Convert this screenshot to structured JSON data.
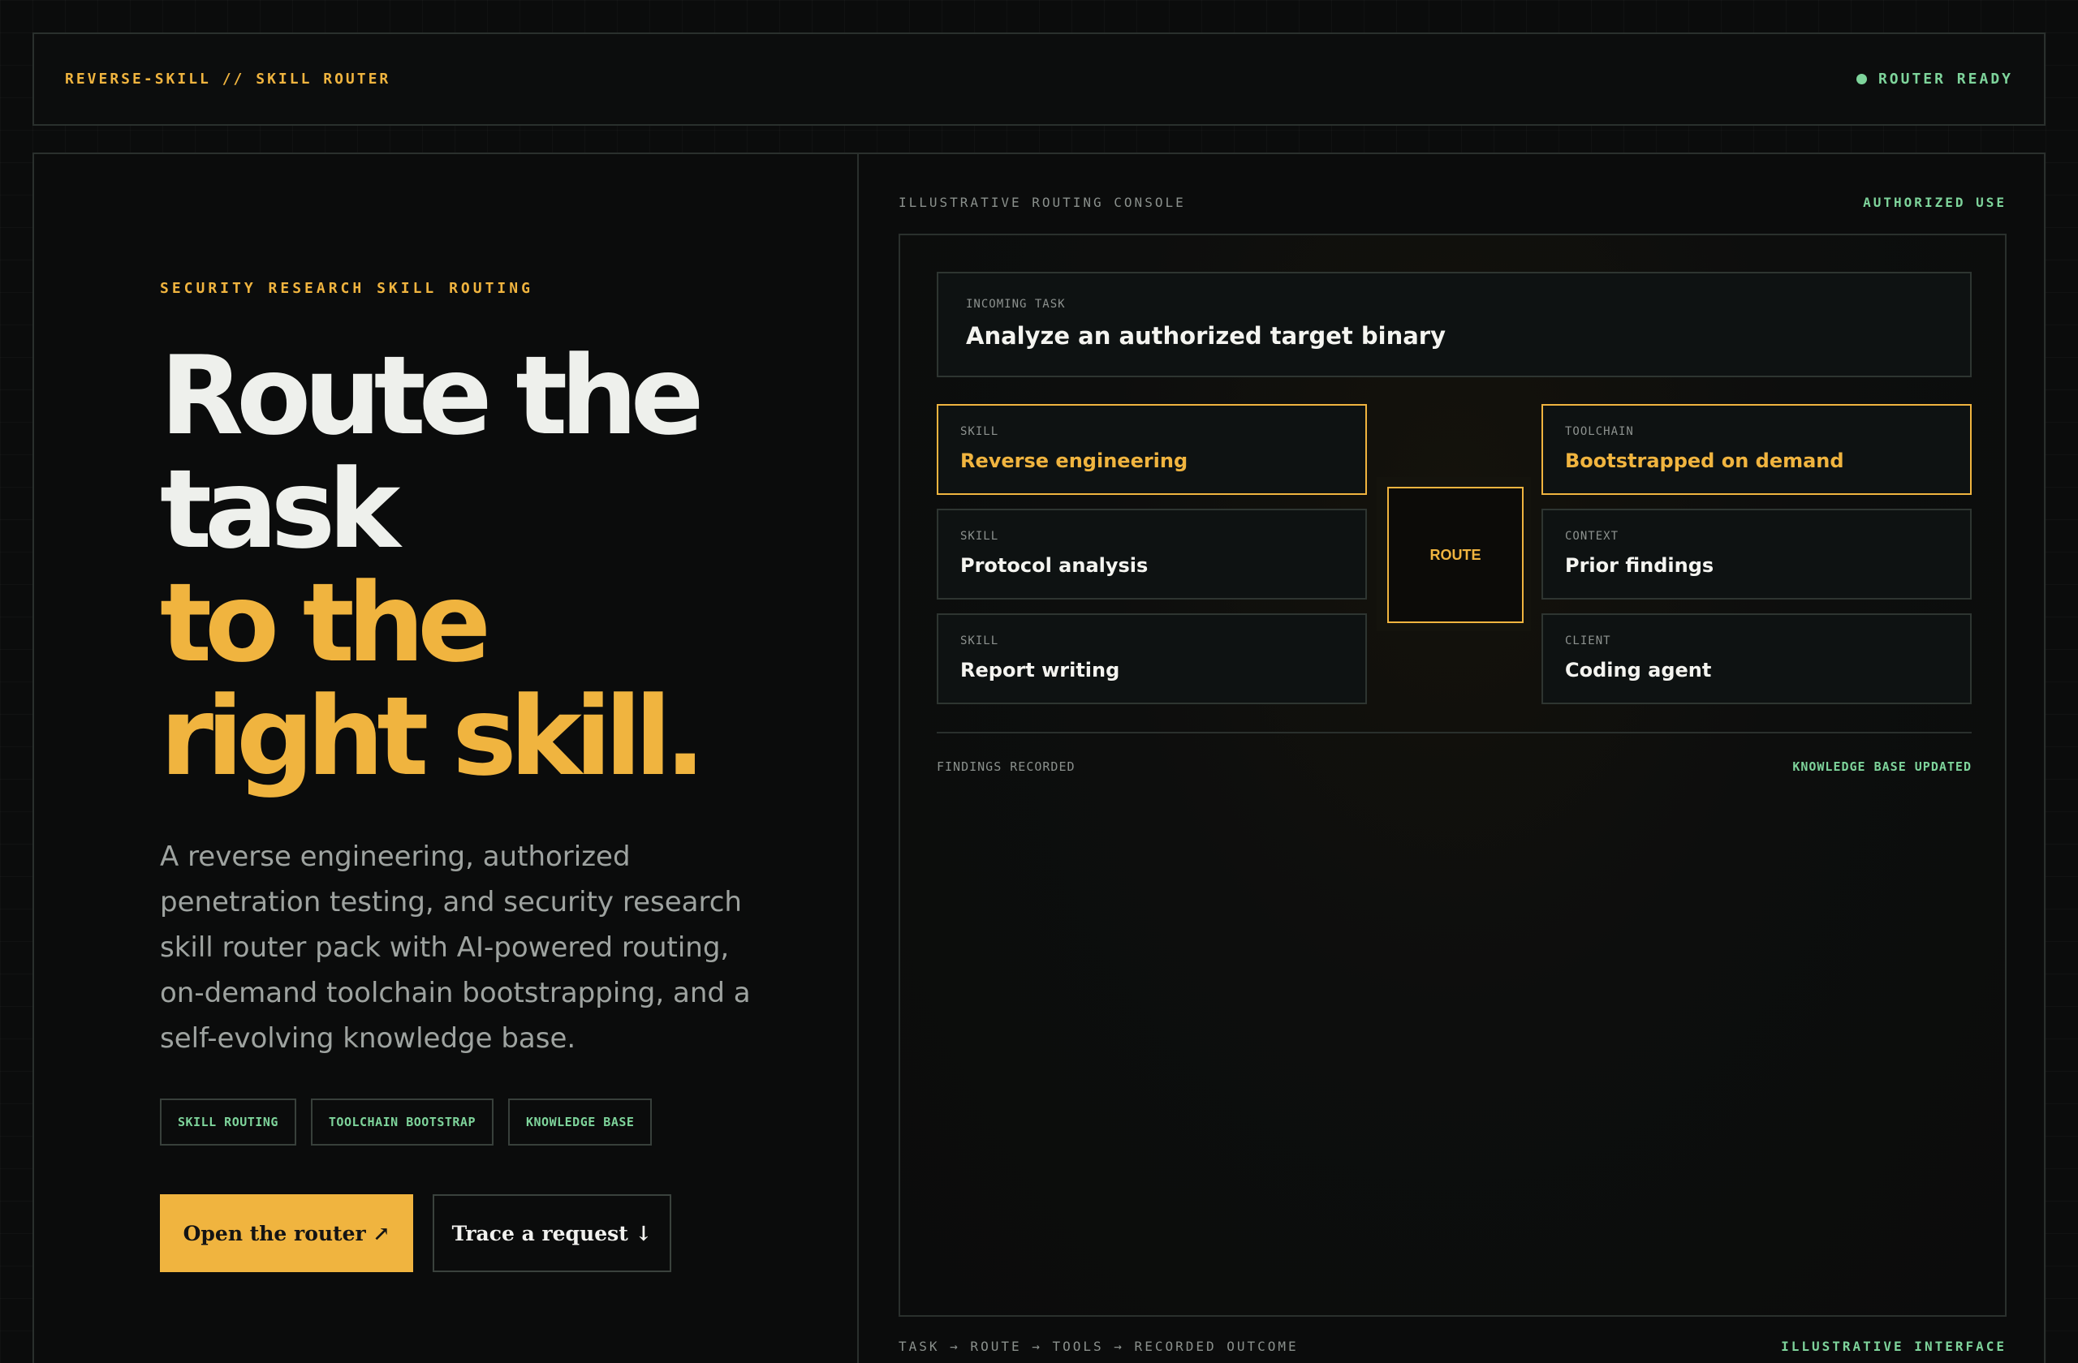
{
  "topbar": {
    "brand": "REVERSE-SKILL // SKILL ROUTER",
    "status": "ROUTER READY"
  },
  "hero": {
    "eyebrow": "SECURITY RESEARCH SKILL ROUTING",
    "headline_line1": "Route the",
    "headline_line2": "task",
    "headline_line3": "to the",
    "headline_line4": "right skill.",
    "lede": "A reverse engineering, authorized penetration testing, and security research skill router pack with AI-powered routing, on-demand toolchain bootstrapping, and a self-evolving knowledge base.",
    "tags": [
      "SKILL ROUTING",
      "TOOLCHAIN BOOTSTRAP",
      "KNOWLEDGE BASE"
    ],
    "primary_cta": "Open the router ↗",
    "secondary_cta": "Trace a request ↓"
  },
  "console": {
    "header_left": "ILLUSTRATIVE ROUTING CONSOLE",
    "header_right": "AUTHORIZED USE",
    "incoming_label": "INCOMING TASK",
    "incoming_title": "Analyze an authorized target binary",
    "skills": [
      {
        "label": "SKILL",
        "value": "Reverse engineering",
        "highlight": true
      },
      {
        "label": "SKILL",
        "value": "Protocol analysis",
        "highlight": false
      },
      {
        "label": "SKILL",
        "value": "Report writing",
        "highlight": false
      }
    ],
    "route_label": "ROUTE",
    "targets": [
      {
        "label": "TOOLCHAIN",
        "value": "Bootstrapped on demand",
        "highlight": true
      },
      {
        "label": "CONTEXT",
        "value": "Prior findings",
        "highlight": false
      },
      {
        "label": "CLIENT",
        "value": "Coding agent",
        "highlight": false
      }
    ],
    "findings_left": "FINDINGS RECORDED",
    "findings_right": "KNOWLEDGE BASE UPDATED",
    "footer_left": "TASK → ROUTE → TOOLS → RECORDED OUTCOME",
    "footer_right": "ILLUSTRATIVE INTERFACE"
  },
  "colors": {
    "accent": "#f0b43f",
    "success": "#7ed49b",
    "background": "#0b0c0c"
  }
}
